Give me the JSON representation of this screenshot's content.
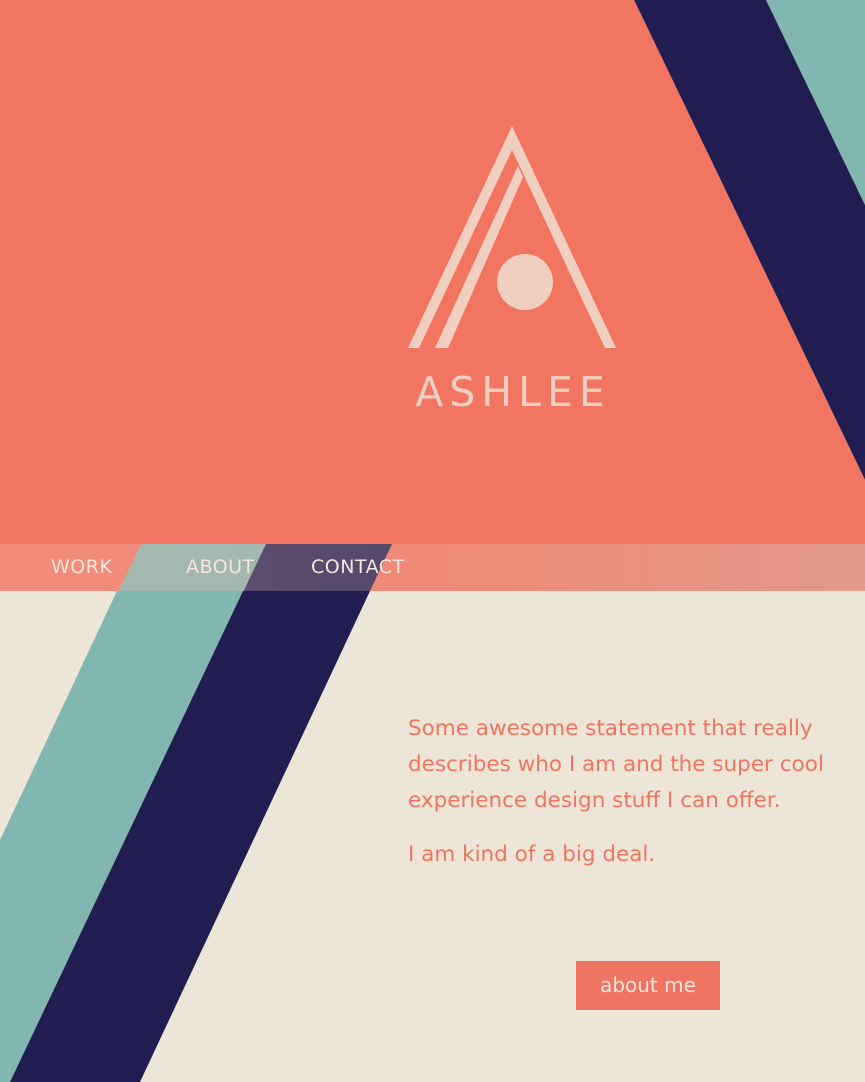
{
  "brand": {
    "name": "ASHLEE",
    "logo_icon": "a-monogram-icon"
  },
  "nav": {
    "items": [
      {
        "label": "WORK"
      },
      {
        "label": "ABOUT"
      },
      {
        "label": "CONTACT"
      }
    ]
  },
  "intro": {
    "statement_lines": [
      "Some awesome statement that really",
      "describes who I am and the super cool",
      "experience design stuff I can offer."
    ],
    "tagline": "I am kind of a big deal."
  },
  "cta": {
    "about_label": "about me"
  },
  "colors": {
    "coral": "#f27562",
    "navy": "#221d51",
    "teal": "#82b6b1",
    "cream": "#ede6d8",
    "logo_tint": "#f0cfc0"
  }
}
